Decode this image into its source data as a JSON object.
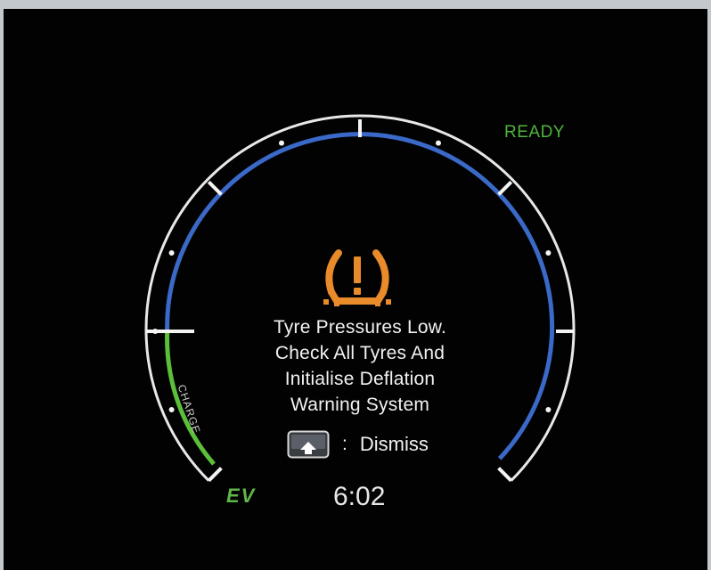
{
  "status": {
    "ready": "READY"
  },
  "warning": {
    "icon": "tyre-pressure-warning-icon",
    "color": "#e98a2b",
    "lines": [
      "Tyre Pressures Low.",
      "Check All Tyres And",
      "Initialise Deflation",
      "Warning System"
    ]
  },
  "dismiss": {
    "key_icon": "enter-key-icon",
    "separator": ":",
    "label": "Dismiss"
  },
  "gauge": {
    "charge_label": "CHARGE",
    "colors": {
      "ring": "#e8e8e8",
      "power": "#3a69c8",
      "charge": "#5cbf3a"
    }
  },
  "mode": {
    "ev_label": "EV"
  },
  "clock": {
    "time": "6:02"
  }
}
